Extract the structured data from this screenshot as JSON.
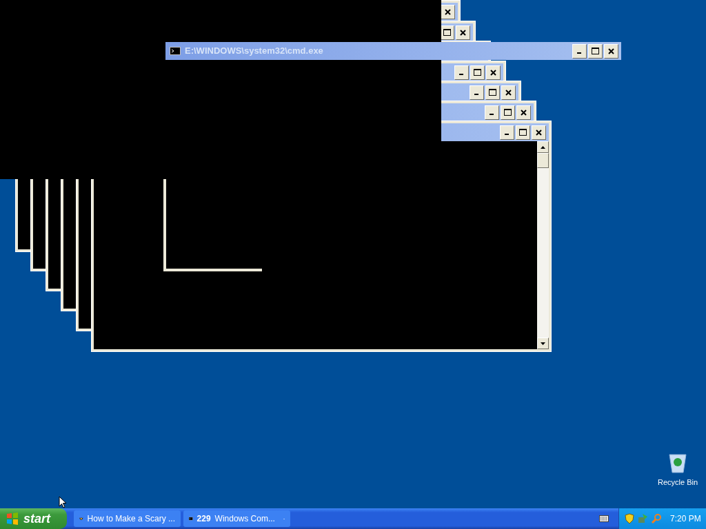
{
  "console_window": {
    "title": "E:\\WINDOWS\\system32\\cmd.exe",
    "active": false
  },
  "desktop_icons": [
    {
      "label": "Recycle Bin"
    }
  ],
  "taskbar": {
    "start_label": "start",
    "tasks": [
      {
        "kind": "browser",
        "label": "How to Make a Scary ...",
        "selected": false
      },
      {
        "kind": "group",
        "count": "229",
        "label": "Windows Com...",
        "selected": false
      }
    ],
    "clock": "7:20 PM"
  }
}
